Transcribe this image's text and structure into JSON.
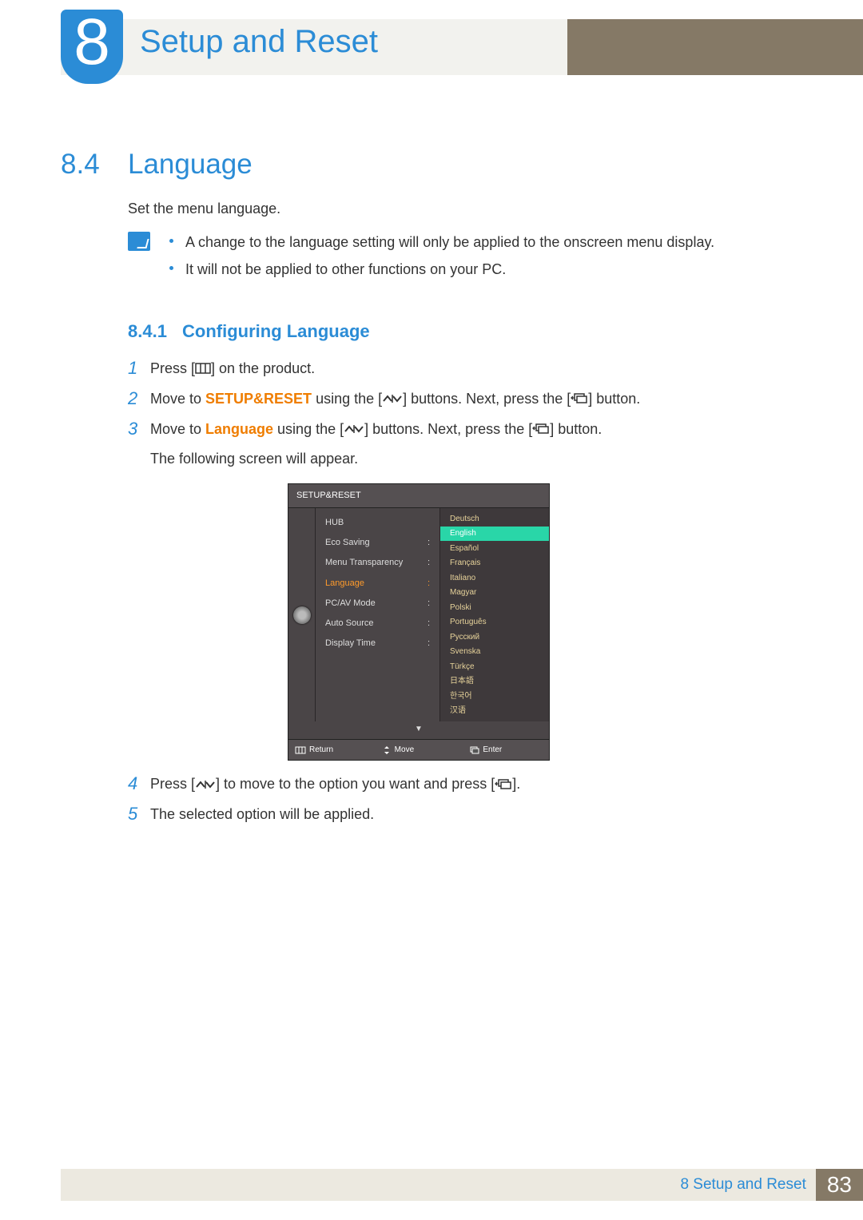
{
  "chapter": {
    "number": "8",
    "title": "Setup and Reset"
  },
  "section": {
    "number": "8.4",
    "title": "Language"
  },
  "intro": "Set the menu language.",
  "notes": [
    "A change to the language setting will only be applied to the onscreen menu display.",
    "It will not be applied to other functions on your PC."
  ],
  "subsection": {
    "number": "8.4.1",
    "title": "Configuring Language"
  },
  "steps": {
    "s1a": "Press [",
    "s1b": "] on the product.",
    "s2a": "Move to ",
    "s2hl": "SETUP&RESET",
    "s2b": " using the [",
    "s2c": "] buttons. Next, press the [",
    "s2d": "] button.",
    "s3a": "Move to ",
    "s3hl": "Language",
    "s3b": " using the [",
    "s3c": "] buttons. Next, press the [",
    "s3d": "] button.",
    "s3note": "The following screen will appear.",
    "s4a": "Press [",
    "s4b": "] to move to the option you want and press [",
    "s4c": "].",
    "s5": "The selected option will be applied."
  },
  "osd": {
    "title": "SETUP&RESET",
    "menu": [
      {
        "label": "HUB",
        "suffix": ""
      },
      {
        "label": "Eco Saving",
        "suffix": ":"
      },
      {
        "label": "Menu Transparency",
        "suffix": ":"
      },
      {
        "label": "Language",
        "suffix": ":",
        "hl": true
      },
      {
        "label": "PC/AV Mode",
        "suffix": ":"
      },
      {
        "label": "Auto Source",
        "suffix": ":"
      },
      {
        "label": "Display Time",
        "suffix": ":"
      }
    ],
    "langs": [
      "Deutsch",
      "English",
      "Español",
      "Français",
      "Italiano",
      "Magyar",
      "Polski",
      "Português",
      "Русский",
      "Svenska",
      "Türkçe",
      "日本語",
      "한국어",
      "汉语"
    ],
    "selected_lang_index": 1,
    "footer": {
      "return": "Return",
      "move": "Move",
      "enter": "Enter"
    }
  },
  "footer": {
    "chapter_ref": "8 Setup and Reset",
    "page": "83"
  }
}
